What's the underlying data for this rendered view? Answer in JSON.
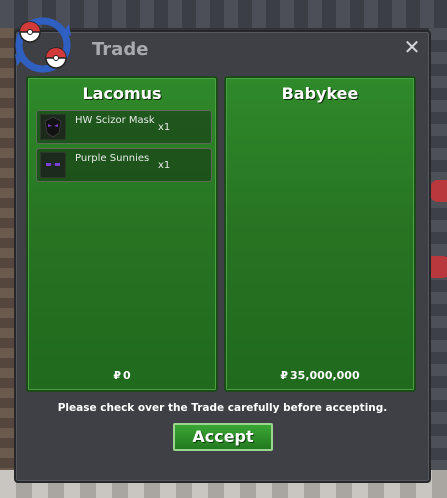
{
  "window": {
    "title": "Trade",
    "close_label": "✕"
  },
  "left_party": {
    "name": "Lacomus",
    "items": [
      {
        "name": "HW Scizor Mask",
        "qty": "x1",
        "icon": "scizor-mask-icon"
      },
      {
        "name": "Purple Sunnies",
        "qty": "x1",
        "icon": "purple-sunnies-icon"
      }
    ],
    "money_symbol": "₽",
    "money": "0"
  },
  "right_party": {
    "name": "Babykee",
    "items": [],
    "money_symbol": "₽",
    "money": "35,000,000"
  },
  "notice": "Please check over the Trade carefully before accepting.",
  "accept_label": "Accept",
  "colors": {
    "panel_green": "#277523",
    "dialog_bg": "#3f4045",
    "accept": "#2f9129"
  }
}
